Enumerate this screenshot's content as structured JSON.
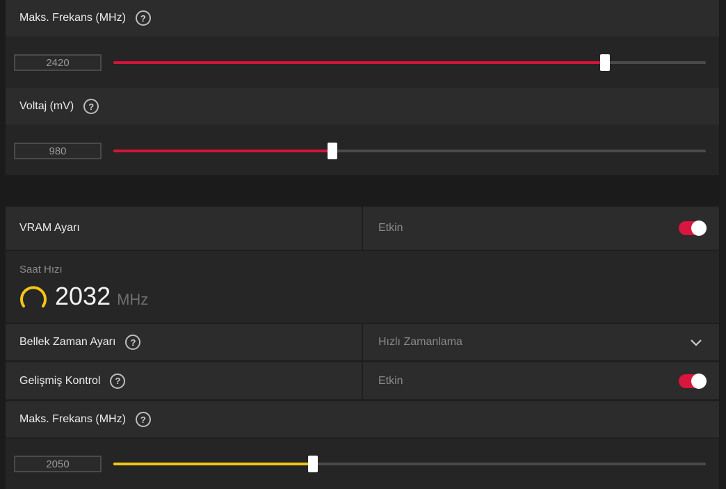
{
  "top_section": {
    "max_freq": {
      "label": "Maks. Frekans (MHz)",
      "value": "2420",
      "fraction": 0.83,
      "color": "#d41438"
    },
    "voltage": {
      "label": "Voltaj (mV)",
      "value": "980",
      "fraction": 0.37,
      "color": "#d41438"
    }
  },
  "vram": {
    "title": "VRAM Ayarı",
    "status": "Etkin",
    "enabled": true,
    "clock": {
      "label": "Saat Hızı",
      "value": "2032",
      "unit": "MHz",
      "gauge_color": "#f5c518"
    },
    "memory_timing": {
      "label": "Bellek Zaman Ayarı",
      "selected": "Hızlı Zamanlama"
    },
    "advanced": {
      "label": "Gelişmiş Kontrol",
      "status": "Etkin",
      "enabled": true
    },
    "max_freq": {
      "label": "Maks. Frekans (MHz)",
      "value": "2050",
      "fraction": 0.337,
      "color": "#f5c518"
    }
  },
  "colors": {
    "accent_red": "#d41438",
    "accent_yellow": "#f5c518",
    "toggle_on": "#d8163e"
  },
  "icons": [
    "help-icon",
    "gauge-icon",
    "chevron-down-icon"
  ]
}
